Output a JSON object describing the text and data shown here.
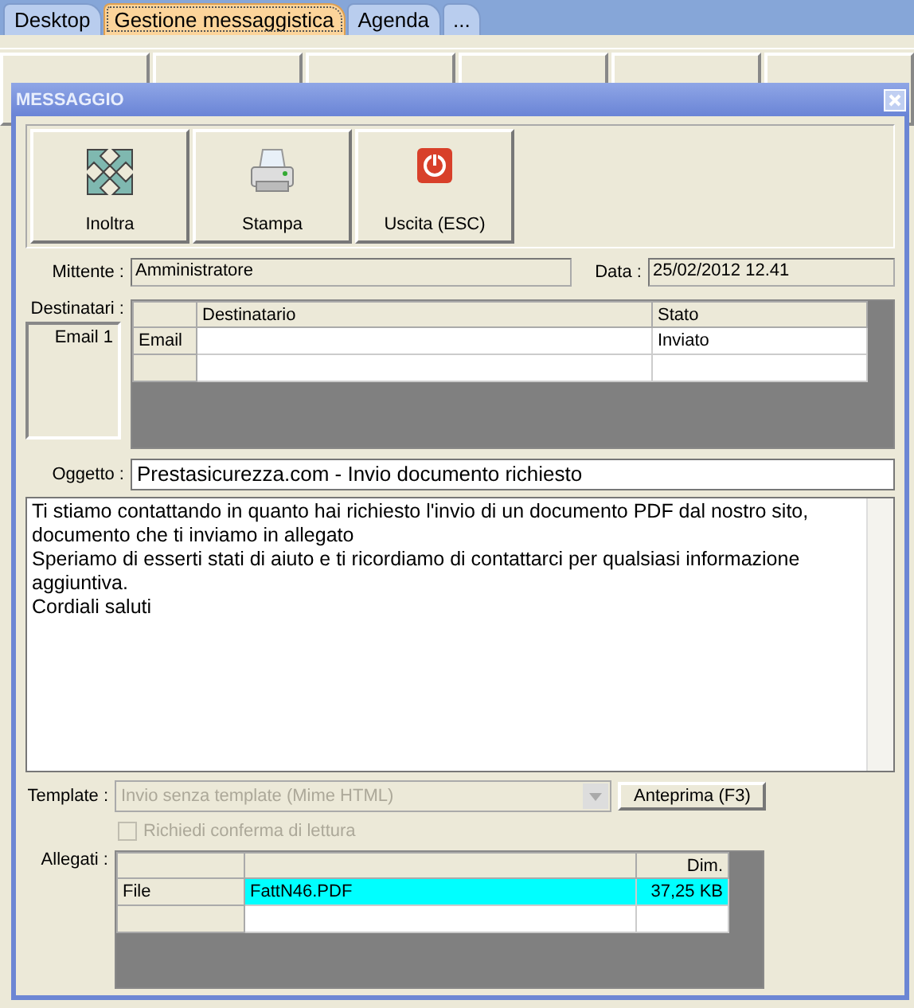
{
  "tabs": [
    {
      "label": "Desktop",
      "selected": false
    },
    {
      "label": "Gestione messaggistica",
      "selected": true
    },
    {
      "label": "Agenda",
      "selected": false
    },
    {
      "label": "...",
      "selected": false
    }
  ],
  "dialog": {
    "title": "MESSAGGIO",
    "toolbar": [
      {
        "label": "Inoltra",
        "kind": "forward"
      },
      {
        "label": "Stampa",
        "kind": "print"
      },
      {
        "label": "Uscita (ESC)",
        "kind": "exit"
      }
    ],
    "sender_label": "Mittente :",
    "sender": "Amministratore",
    "date_label": "Data :",
    "date": "25/02/2012 12.41",
    "recipients": {
      "label": "Destinatari :",
      "side_item": "Email 1",
      "columns": [
        "Destinatario",
        "Stato"
      ],
      "rows": [
        {
          "type": "Email",
          "status": "Inviato"
        }
      ]
    },
    "subject_label": "Oggetto :",
    "subject": "Prestasicurezza.com - Invio documento richiesto",
    "body": [
      "Ti stiamo contattando in quanto hai richiesto l'invio di un documento PDF dal nostro sito, documento che ti inviamo in allegato",
      "Speriamo di esserti stati di aiuto e ti ricordiamo di contattarci per qualsiasi informazione aggiuntiva.",
      "Cordiali saluti"
    ],
    "template": {
      "label": "Template :",
      "value": "Invio senza template (Mime HTML)",
      "disabled": true
    },
    "preview_button": "Anteprima (F3)",
    "read_receipt": {
      "label": "Richiedi conferma di lettura",
      "checked": false,
      "disabled": true
    },
    "attachments": {
      "label": "Allegati :",
      "size_column": "Dim.",
      "rows": [
        {
          "type": "File",
          "name": "FattN46.PDF",
          "size": "37,25 KB",
          "selected": true
        }
      ]
    }
  }
}
